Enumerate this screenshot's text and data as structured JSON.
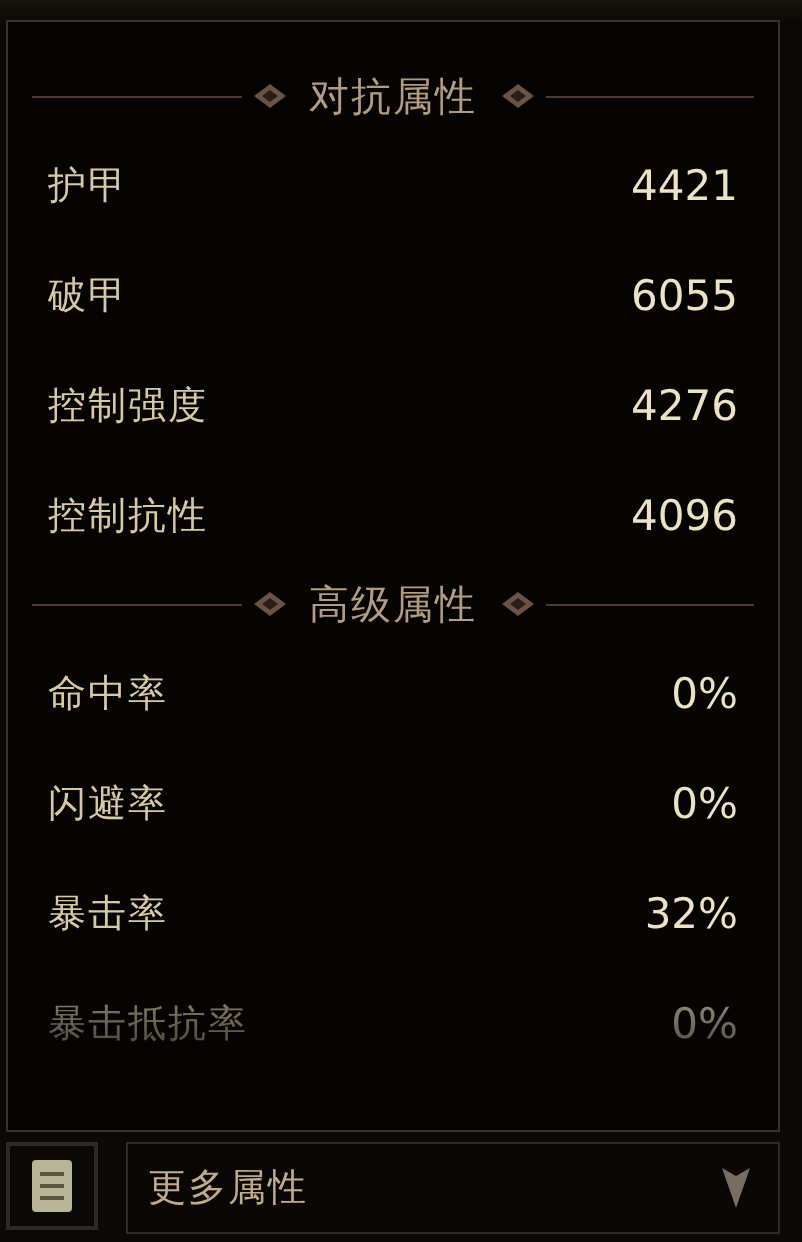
{
  "sections": [
    {
      "title": "对抗属性",
      "rows": [
        {
          "label": "护甲",
          "value": "4421"
        },
        {
          "label": "破甲",
          "value": "6055"
        },
        {
          "label": "控制强度",
          "value": "4276"
        },
        {
          "label": "控制抗性",
          "value": "4096"
        }
      ]
    },
    {
      "title": "高级属性",
      "rows": [
        {
          "label": "命中率",
          "value": "0%"
        },
        {
          "label": "闪避率",
          "value": "0%"
        },
        {
          "label": "暴击率",
          "value": "32%"
        },
        {
          "label": "暴击抵抗率",
          "value": "0%"
        }
      ]
    }
  ],
  "dropdown": {
    "label": "更多属性"
  }
}
